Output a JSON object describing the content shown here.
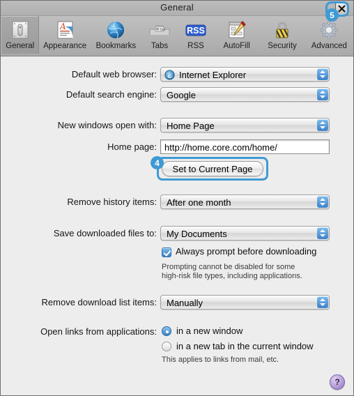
{
  "window": {
    "title": "General",
    "close_label": "x"
  },
  "toolbar": {
    "items": [
      {
        "label": "General",
        "icon": "general-switch-icon",
        "selected": true
      },
      {
        "label": "Appearance",
        "icon": "appearance-icon",
        "selected": false
      },
      {
        "label": "Bookmarks",
        "icon": "bookmarks-globe-icon",
        "selected": false
      },
      {
        "label": "Tabs",
        "icon": "tabs-icon",
        "selected": false
      },
      {
        "label": "RSS",
        "icon": "rss-icon",
        "selected": false
      },
      {
        "label": "AutoFill",
        "icon": "autofill-pencil-icon",
        "selected": false
      },
      {
        "label": "Security",
        "icon": "security-lock-icon",
        "selected": false
      },
      {
        "label": "Advanced",
        "icon": "advanced-gear-icon",
        "selected": false
      }
    ]
  },
  "form": {
    "default_browser": {
      "label": "Default web browser:",
      "value": "Internet Explorer",
      "icon": "internet-explorer-icon"
    },
    "default_search": {
      "label": "Default search engine:",
      "value": "Google"
    },
    "new_windows": {
      "label": "New windows open with:",
      "value": "Home Page"
    },
    "home_page": {
      "label": "Home page:",
      "value": "http://home.core.com/home/"
    },
    "set_current": {
      "label": "Set to Current Page"
    },
    "remove_history": {
      "label": "Remove history items:",
      "value": "After one month"
    },
    "save_downloads": {
      "label": "Save downloaded files to:",
      "value": "My Documents"
    },
    "always_prompt": {
      "label": "Always prompt before downloading",
      "checked": true
    },
    "prompt_note_line1": "Prompting cannot be disabled for some",
    "prompt_note_line2": "high-risk file types, including applications.",
    "remove_download_list": {
      "label": "Remove download list items:",
      "value": "Manually"
    },
    "open_links": {
      "label": "Open links from applications:",
      "option1": "in a new window",
      "option2": "in a new tab in the current window",
      "selected": "option1",
      "note": "This applies to links from mail, etc."
    }
  },
  "help": {
    "label": "?"
  },
  "annotations": {
    "badge_color": "#3f9ad4",
    "items": [
      {
        "number": "4",
        "target": "set-to-current-page-button"
      },
      {
        "number": "5",
        "target": "close-button"
      }
    ]
  }
}
